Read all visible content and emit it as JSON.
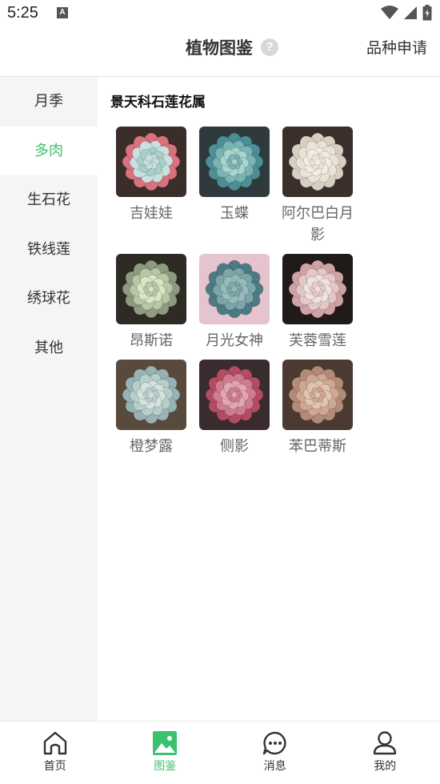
{
  "status_bar": {
    "time": "5:25",
    "notification_glyph": "A"
  },
  "header": {
    "title": "植物图鉴",
    "help_glyph": "?",
    "apply_label": "品种申请"
  },
  "sidebar": {
    "items": [
      {
        "label": "月季"
      },
      {
        "label": "多肉",
        "active": true
      },
      {
        "label": "生石花"
      },
      {
        "label": "铁线莲"
      },
      {
        "label": "绣球花"
      },
      {
        "label": "其他"
      }
    ]
  },
  "content": {
    "genus_title": "景天科石莲花属",
    "plants": [
      {
        "name": "吉娃娃",
        "colors": {
          "bg": "#3b2e2a",
          "outer": "#d9727d",
          "mid": "#c9dfe0",
          "inner": "#a8d0c8"
        }
      },
      {
        "name": "玉蝶",
        "colors": {
          "bg": "#2f3a3c",
          "outer": "#4d8f96",
          "mid": "#7bb4b4",
          "inner": "#a8d6cf"
        }
      },
      {
        "name": "阿尔巴白月影",
        "colors": {
          "bg": "#3a2f2b",
          "outer": "#d8cfc4",
          "mid": "#ebe3d6",
          "inner": "#f3ece2"
        }
      },
      {
        "name": "昂斯诺",
        "colors": {
          "bg": "#2e2a24",
          "outer": "#8e9a82",
          "mid": "#b8c7a6",
          "inner": "#dbe6c8"
        }
      },
      {
        "name": "月光女神",
        "colors": {
          "bg": "#e5c4cf",
          "outer": "#4c7b83",
          "mid": "#7da6a8",
          "inner": "#98bcbd"
        }
      },
      {
        "name": "芙蓉雪莲",
        "colors": {
          "bg": "#201a18",
          "outer": "#cfa3a6",
          "mid": "#e3c8c6",
          "inner": "#f0e3df"
        }
      },
      {
        "name": "橙梦露",
        "colors": {
          "bg": "#5a4a3e",
          "outer": "#97b3b5",
          "mid": "#b8cdcc",
          "inner": "#d5e2de"
        }
      },
      {
        "name": "侧影",
        "colors": {
          "bg": "#3a2c2e",
          "outer": "#b24c63",
          "mid": "#cf7d8e",
          "inner": "#e2a7b0"
        }
      },
      {
        "name": "苯巴蒂斯",
        "colors": {
          "bg": "#4a3a32",
          "outer": "#b48b78",
          "mid": "#cfa793",
          "inner": "#e2c4b2"
        }
      }
    ]
  },
  "tabbar": {
    "accent": "#3cc26c",
    "items": [
      {
        "label": "首页",
        "icon": "home-icon"
      },
      {
        "label": "图鉴",
        "icon": "gallery-icon",
        "active": true
      },
      {
        "label": "消息",
        "icon": "message-icon"
      },
      {
        "label": "我的",
        "icon": "profile-icon"
      }
    ]
  }
}
